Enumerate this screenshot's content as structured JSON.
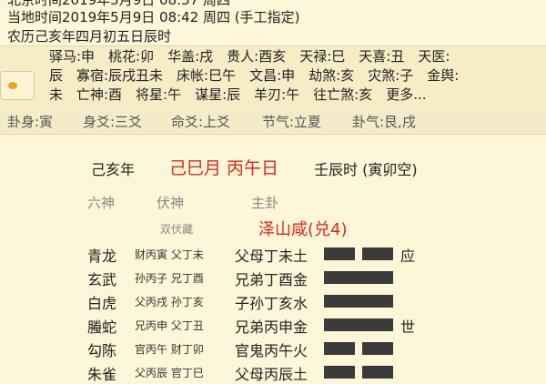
{
  "header": {
    "line0": "北京时间2019年5月9日 08:37 周四",
    "line1": "当地时间2019年5月9日 08:42 周四 (手工指定)",
    "line2": "农历己亥年四月初五日辰时"
  },
  "gods": {
    "row1": "驿马:申　桃花:卯　华盖:戌　贵人:酉亥　天禄:巳　天喜:丑　天医:",
    "row2": "辰　寡宿:辰戌丑未　床帐:巳午　文昌:申　劫煞:亥　灾煞:子　金舆:",
    "row3": "未　亡神:酉　将星:午　谋星:辰　羊刃:午　往亡煞:亥　更多..."
  },
  "info": {
    "guashen": "卦身:寅",
    "shenyao": "身爻:三爻",
    "mingyao": "命爻:上爻",
    "jieqi": "节气:立夏",
    "guaqi": "卦气:艮,戌"
  },
  "ganzhi": {
    "year": "己亥年",
    "month_day": "己巳月 丙午日",
    "hour": "壬辰时 (寅卯空)"
  },
  "columns": {
    "liushen": "六神",
    "fushen": "伏神",
    "zhugua": "主卦"
  },
  "sub_label": "双伏藏",
  "gua_name": "泽山咸(兑4)",
  "lines": [
    {
      "shen": "青龙",
      "fu": "财丙寅 父丁未",
      "zhu": "父母丁未土",
      "yin": true,
      "mark": "应"
    },
    {
      "shen": "玄武",
      "fu": "孙丙子 兄丁酉",
      "zhu": "兄弟丁酉金",
      "yin": false,
      "mark": ""
    },
    {
      "shen": "白虎",
      "fu": "父丙戌 孙丁亥",
      "zhu": "子孙丁亥水",
      "yin": false,
      "mark": ""
    },
    {
      "shen": "螣蛇",
      "fu": "兄丙申 父丁丑",
      "zhu": "兄弟丙申金",
      "yin": false,
      "mark": "世"
    },
    {
      "shen": "勾陈",
      "fu": "官丙午 财丁卯",
      "zhu": "官鬼丙午火",
      "yin": true,
      "mark": ""
    },
    {
      "shen": "朱雀",
      "fu": "父丙辰 官丁巳",
      "zhu": "父母丙辰土",
      "yin": true,
      "mark": ""
    }
  ],
  "colors": {
    "accent": "#d62b1e",
    "bg": "#fdf6d8",
    "yao": "#3a3a3a"
  }
}
